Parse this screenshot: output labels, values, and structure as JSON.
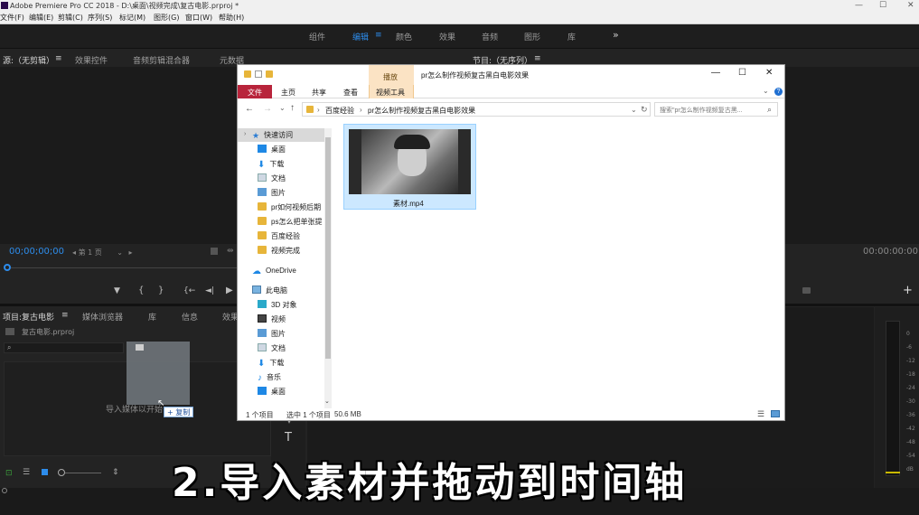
{
  "window": {
    "title": "Adobe Premiere Pro CC 2018 - D:\\桌面\\视频完成\\复古电影.prproj *",
    "min": "—",
    "max": "☐",
    "close": "✕"
  },
  "menu": [
    "文件(F)",
    "编辑(E)",
    "剪辑(C)",
    "序列(S)",
    "标记(M)",
    "图形(G)",
    "窗口(W)",
    "帮助(H)"
  ],
  "workspaces": {
    "items": [
      "组件",
      "编辑",
      "颜色",
      "效果",
      "音频",
      "图形",
      "库"
    ],
    "active": "编辑",
    "more": "»"
  },
  "source_panel": {
    "tabs": [
      "源:（无剪辑）",
      "效果控件",
      "音频剪辑混合器",
      "元数据"
    ],
    "timecode": "00;00;00;00",
    "page": "第 1 页",
    "controls": [
      "▼",
      "{",
      "}",
      "{←",
      "◄|",
      "▶"
    ]
  },
  "program_panel": {
    "title": "节目:（无序列）",
    "timecode": "00:00:00:00",
    "add": "+"
  },
  "project_panel": {
    "tabs": [
      "项目:复古电影",
      "媒体浏览器",
      "库",
      "信息",
      "效果"
    ],
    "file": "复古电影.prproj",
    "import_hint": "导入媒体以开始",
    "drag_copy": "+ 复制"
  },
  "tools": {
    "type_tool": "T"
  },
  "explorer": {
    "title": "pr怎么制作视频复古黑白电影效果",
    "context_tab": "播放",
    "ribbon_tabs": [
      "文件",
      "主页",
      "共享",
      "查看",
      "视频工具"
    ],
    "address": [
      "百度经验",
      "pr怎么制作视频复古黑白电影效果"
    ],
    "search_placeholder": "搜索\"pr怎么制作视频复古黑...",
    "nav": {
      "quick_access": "快速访问",
      "quick_items": [
        "桌面",
        "下载",
        "文档",
        "图片",
        "pr如何视频后期",
        "ps怎么把单张提",
        "百度经验",
        "视频完成"
      ],
      "onedrive": "OneDrive",
      "this_pc": "此电脑",
      "pc_items": [
        "3D 对象",
        "视频",
        "图片",
        "文档",
        "下载",
        "音乐",
        "桌面"
      ]
    },
    "file": {
      "name": "素材.mp4"
    },
    "status": {
      "count": "1 个项目",
      "selected": "选中 1 个项目",
      "size": "50.6 MB"
    }
  },
  "subtitle": "2.导入素材并拖动到时间轴"
}
